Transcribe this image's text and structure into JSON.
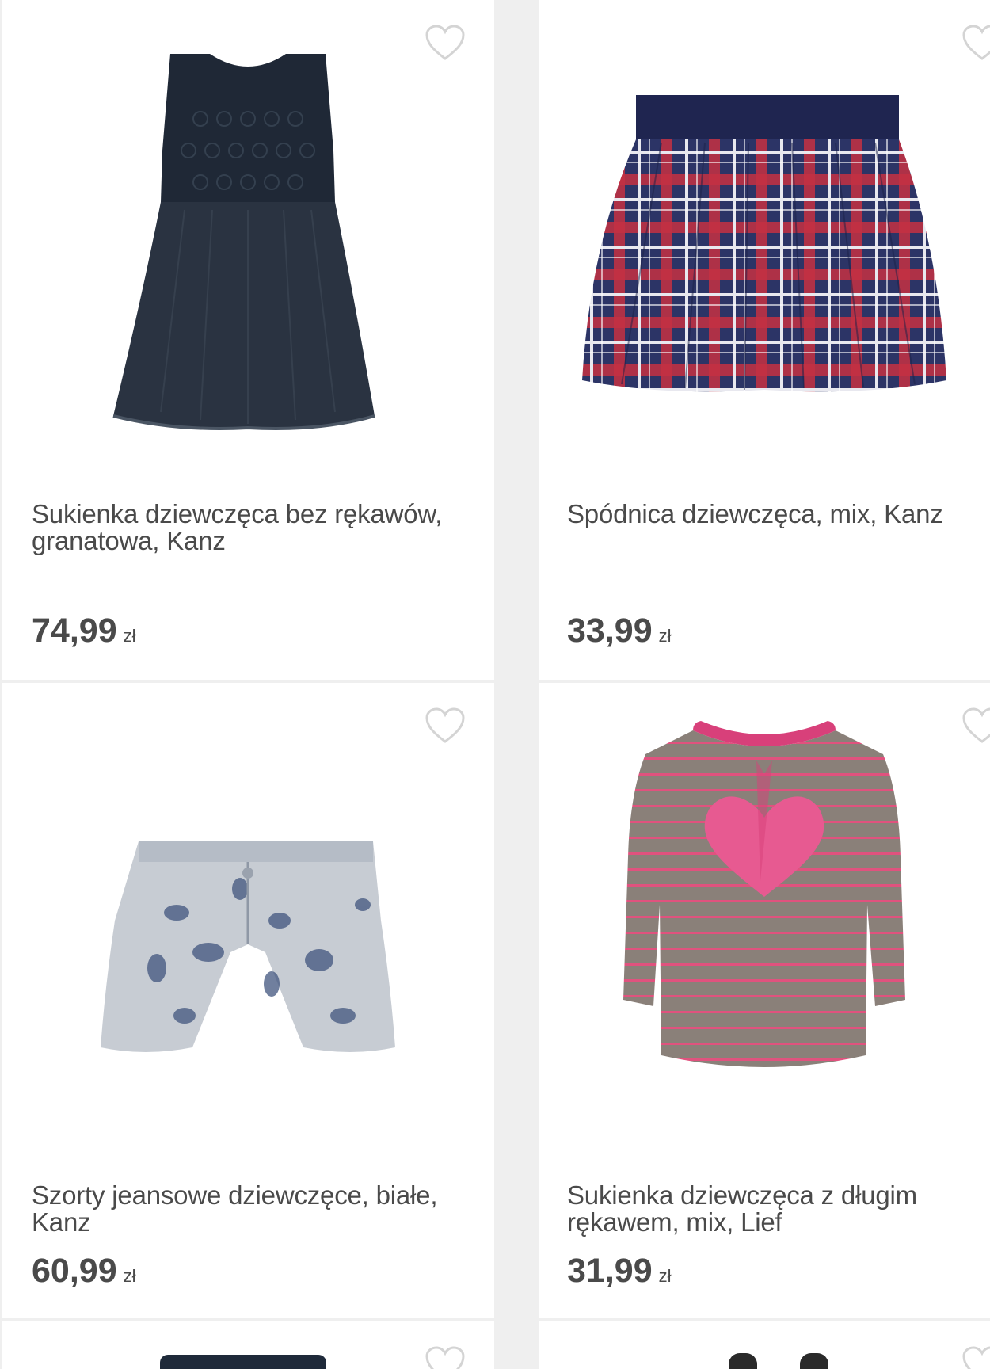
{
  "products": [
    {
      "title": "Sukienka dziewczęca bez rękawów, granatowa, Kanz",
      "price": "74,99",
      "currency": "zł",
      "image_icon": "navy-dress-image",
      "favorite_icon": "heart-outline-icon"
    },
    {
      "title": "Spódnica dziewczęca, mix, Kanz",
      "price": "33,99",
      "currency": "zł",
      "image_icon": "plaid-skirt-image",
      "favorite_icon": "heart-outline-icon"
    },
    {
      "title": "Szorty jeansowe dziewczęce, białe, Kanz",
      "price": "60,99",
      "currency": "zł",
      "image_icon": "denim-shorts-image",
      "favorite_icon": "heart-outline-icon"
    },
    {
      "title": "Sukienka dziewczęca z długim rękawem, mix, Lief",
      "price": "31,99",
      "currency": "zł",
      "image_icon": "striped-heart-dress-image",
      "favorite_icon": "heart-outline-icon"
    }
  ],
  "colors": {
    "background": "#efefef",
    "card": "#ffffff",
    "text": "#4a4a4a",
    "heart_outline": "#d4d4d4"
  }
}
